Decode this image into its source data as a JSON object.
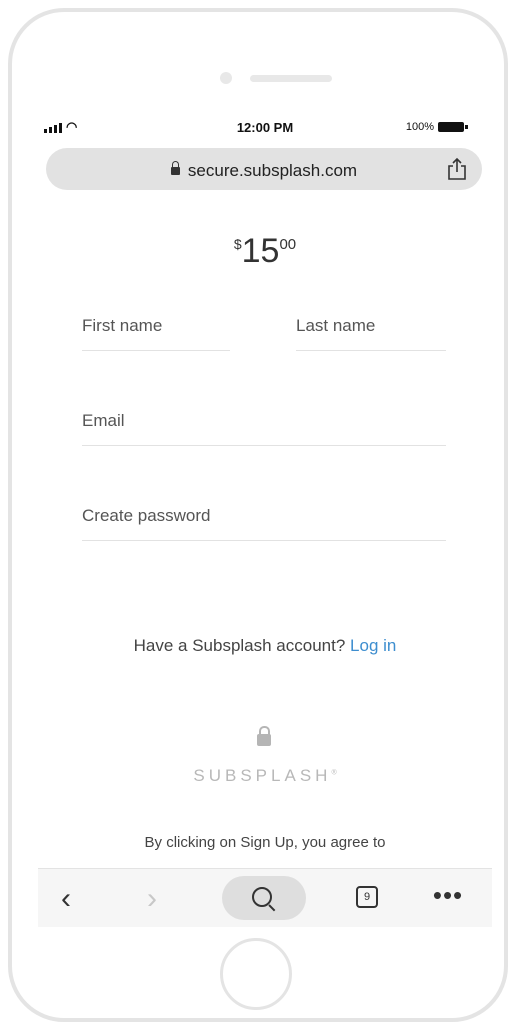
{
  "status_bar": {
    "time": "12:00 PM",
    "battery": "100%"
  },
  "browser": {
    "url": "secure.subsplash.com"
  },
  "price": {
    "currency": "$",
    "amount": "15",
    "cents": "00"
  },
  "form": {
    "first_name_placeholder": "First name",
    "last_name_placeholder": "Last name",
    "email_placeholder": "Email",
    "password_placeholder": "Create password"
  },
  "account": {
    "prompt": "Have a Subsplash account?",
    "login_label": "Log in"
  },
  "brand": {
    "name": "SUBSPLASH"
  },
  "terms": {
    "text": "By clicking on Sign Up, you agree to"
  },
  "toolbar": {
    "tab_count": "9"
  },
  "colors": {
    "link": "#3e8ecf",
    "brand_gray": "#b8b8b8"
  }
}
